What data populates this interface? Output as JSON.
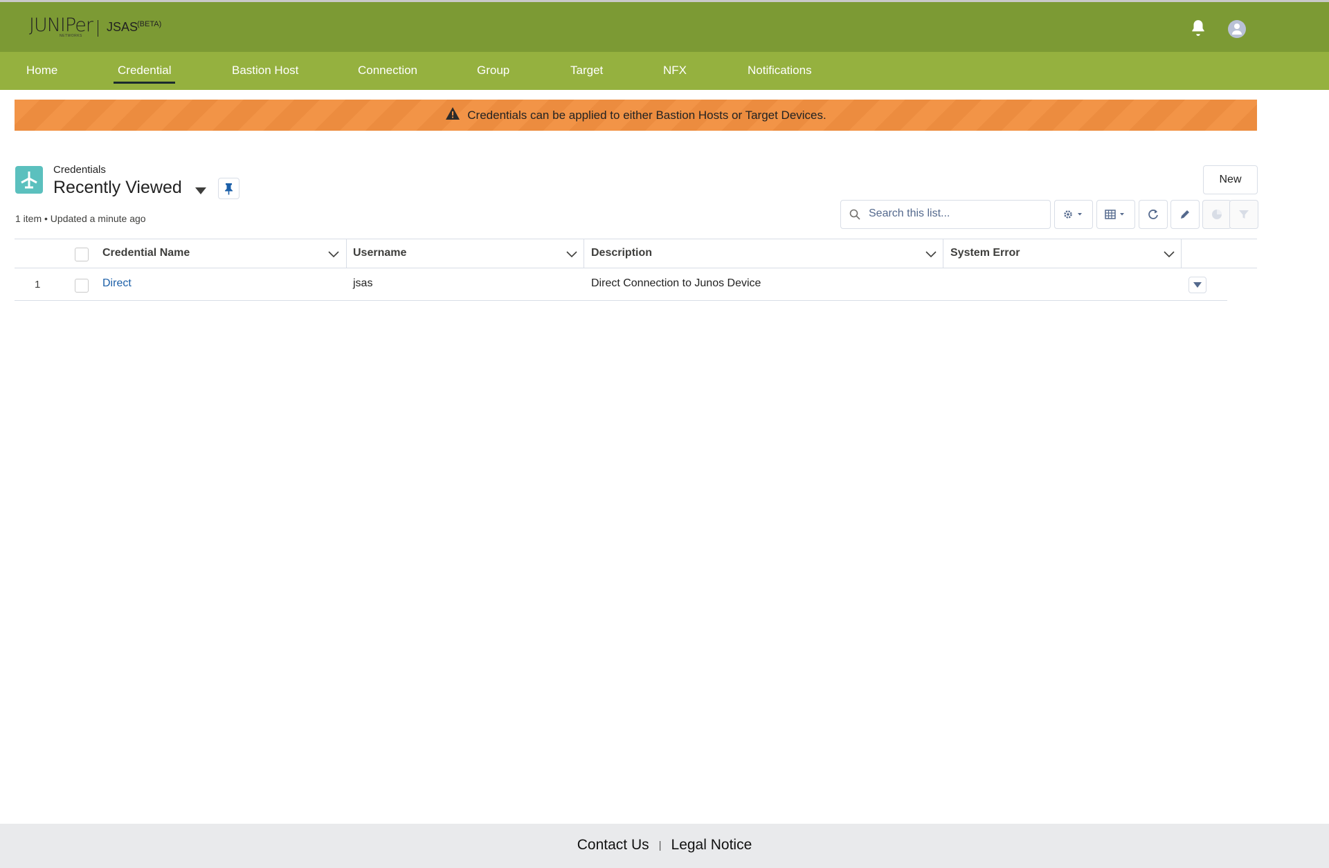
{
  "header": {
    "logo_text": "JUNIPer",
    "logo_sub": "NETWORKS",
    "app_name": "JSAS",
    "app_badge": "(BETA)"
  },
  "nav": {
    "items": [
      {
        "label": "Home"
      },
      {
        "label": "Credential",
        "active": true
      },
      {
        "label": "Bastion Host"
      },
      {
        "label": "Connection"
      },
      {
        "label": "Group"
      },
      {
        "label": "Target"
      },
      {
        "label": "NFX"
      },
      {
        "label": "Notifications"
      }
    ]
  },
  "banner": {
    "text": "Credentials can be applied to either Bastion Hosts or Target Devices.",
    "icon": "warning-icon"
  },
  "list": {
    "object_type": "Credentials",
    "view_name": "Recently Viewed",
    "meta": "1 item • Updated a minute ago",
    "new_label": "New",
    "search_placeholder": "Search this list...",
    "columns": [
      "Credential Name",
      "Username",
      "Description",
      "System Error"
    ],
    "rows": [
      {
        "num": "1",
        "name": "Direct",
        "username": "jsas",
        "description": "Direct Connection to Junos Device",
        "system_error": ""
      }
    ]
  },
  "footer": {
    "contact": "Contact Us",
    "separator": "|",
    "legal": "Legal Notice"
  },
  "colors": {
    "header": "#7c9a34",
    "nav": "#95b13f",
    "banner": "#f29447",
    "object_icon": "#5bc0be",
    "link": "#1b5fa8"
  }
}
